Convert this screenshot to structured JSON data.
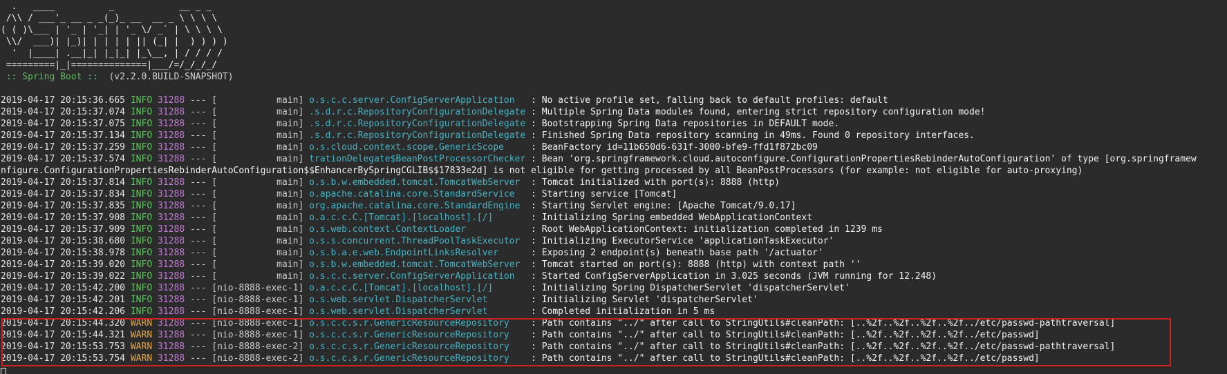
{
  "banner": {
    "art": "  .   ____          _            __ _ _\n /\\\\ / ___'_ __ _ _(_)_ __  __ _ \\ \\ \\ \\\n( ( )\\___ | '_ | '_| | '_ \\/ _` | \\ \\ \\ \\\n \\\\/  ___)| |_)| | | | | || (_| |  ) ) ) )\n  '  |____| .__|_| |_|_| |_\\__, | / / / /\n =========|_|==============|___/=/_/_/_/",
    "label": " :: Spring Boot :: ",
    "version": " (v2.2.0.BUILD-SNAPSHOT)"
  },
  "log_lines": [
    {
      "ts": "2019-04-17 20:15:36.665",
      "level": " INFO",
      "pid": "31288",
      "sep": " --- [           main] ",
      "logger": "o.s.c.c.server.ConfigServerApplication  ",
      "msg": " : No active profile set, falling back to default profiles: default"
    },
    {
      "ts": "2019-04-17 20:15:37.074",
      "level": " INFO",
      "pid": "31288",
      "sep": " --- [           main] ",
      "logger": ".s.d.r.c.RepositoryConfigurationDelegate",
      "msg": " : Multiple Spring Data modules found, entering strict repository configuration mode!"
    },
    {
      "ts": "2019-04-17 20:15:37.075",
      "level": " INFO",
      "pid": "31288",
      "sep": " --- [           main] ",
      "logger": ".s.d.r.c.RepositoryConfigurationDelegate",
      "msg": " : Bootstrapping Spring Data repositories in DEFAULT mode."
    },
    {
      "ts": "2019-04-17 20:15:37.134",
      "level": " INFO",
      "pid": "31288",
      "sep": " --- [           main] ",
      "logger": ".s.d.r.c.RepositoryConfigurationDelegate",
      "msg": " : Finished Spring Data repository scanning in 49ms. Found 0 repository interfaces."
    },
    {
      "ts": "2019-04-17 20:15:37.259",
      "level": " INFO",
      "pid": "31288",
      "sep": " --- [           main] ",
      "logger": "o.s.cloud.context.scope.GenericScope    ",
      "msg": " : BeanFactory id=11b650d6-631f-3000-bfe9-ffd1f872bc09"
    },
    {
      "ts": "2019-04-17 20:15:37.574",
      "level": " INFO",
      "pid": "31288",
      "sep": " --- [           main] ",
      "logger": "trationDelegate$BeanPostProcessorChecker",
      "msg": " : Bean 'org.springframework.cloud.autoconfigure.ConfigurationPropertiesRebinderAutoConfiguration' of type [org.springframew"
    },
    {
      "wrap": "nfigure.ConfigurationPropertiesRebinderAutoConfiguration$$EnhancerBySpringCGLIB$$17833e2d] is not eligible for getting processed by all BeanPostProcessors (for example: not eligible for auto-proxying)"
    },
    {
      "ts": "2019-04-17 20:15:37.814",
      "level": " INFO",
      "pid": "31288",
      "sep": " --- [           main] ",
      "logger": "o.s.b.w.embedded.tomcat.TomcatWebServer ",
      "msg": " : Tomcat initialized with port(s): 8888 (http)"
    },
    {
      "ts": "2019-04-17 20:15:37.834",
      "level": " INFO",
      "pid": "31288",
      "sep": " --- [           main] ",
      "logger": "o.apache.catalina.core.StandardService  ",
      "msg": " : Starting service [Tomcat]"
    },
    {
      "ts": "2019-04-17 20:15:37.835",
      "level": " INFO",
      "pid": "31288",
      "sep": " --- [           main] ",
      "logger": "org.apache.catalina.core.StandardEngine ",
      "msg": " : Starting Servlet engine: [Apache Tomcat/9.0.17]"
    },
    {
      "ts": "2019-04-17 20:15:37.908",
      "level": " INFO",
      "pid": "31288",
      "sep": " --- [           main] ",
      "logger": "o.a.c.c.C.[Tomcat].[localhost].[/]      ",
      "msg": " : Initializing Spring embedded WebApplicationContext"
    },
    {
      "ts": "2019-04-17 20:15:37.909",
      "level": " INFO",
      "pid": "31288",
      "sep": " --- [           main] ",
      "logger": "o.s.web.context.ContextLoader           ",
      "msg": " : Root WebApplicationContext: initialization completed in 1239 ms"
    },
    {
      "ts": "2019-04-17 20:15:38.680",
      "level": " INFO",
      "pid": "31288",
      "sep": " --- [           main] ",
      "logger": "o.s.s.concurrent.ThreadPoolTaskExecutor ",
      "msg": " : Initializing ExecutorService 'applicationTaskExecutor'"
    },
    {
      "ts": "2019-04-17 20:15:38.978",
      "level": " INFO",
      "pid": "31288",
      "sep": " --- [           main] ",
      "logger": "o.s.b.a.e.web.EndpointLinksResolver     ",
      "msg": " : Exposing 2 endpoint(s) beneath base path '/actuator'"
    },
    {
      "ts": "2019-04-17 20:15:39.020",
      "level": " INFO",
      "pid": "31288",
      "sep": " --- [           main] ",
      "logger": "o.s.b.w.embedded.tomcat.TomcatWebServer ",
      "msg": " : Tomcat started on port(s): 8888 (http) with context path ''"
    },
    {
      "ts": "2019-04-17 20:15:39.022",
      "level": " INFO",
      "pid": "31288",
      "sep": " --- [           main] ",
      "logger": "o.s.c.c.server.ConfigServerApplication  ",
      "msg": " : Started ConfigServerApplication in 3.025 seconds (JVM running for 12.248)"
    },
    {
      "ts": "2019-04-17 20:15:42.200",
      "level": " INFO",
      "pid": "31288",
      "sep": " --- [nio-8888-exec-1] ",
      "logger": "o.a.c.c.C.[Tomcat].[localhost].[/]      ",
      "msg": " : Initializing Spring DispatcherServlet 'dispatcherServlet'"
    },
    {
      "ts": "2019-04-17 20:15:42.201",
      "level": " INFO",
      "pid": "31288",
      "sep": " --- [nio-8888-exec-1] ",
      "logger": "o.s.web.servlet.DispatcherServlet       ",
      "msg": " : Initializing Servlet 'dispatcherServlet'"
    },
    {
      "ts": "2019-04-17 20:15:42.206",
      "level": " INFO",
      "pid": "31288",
      "sep": " --- [nio-8888-exec-1] ",
      "logger": "o.s.web.servlet.DispatcherServlet       ",
      "msg": " : Completed initialization in 5 ms"
    },
    {
      "ts": "2019-04-17 20:15:44.320",
      "level": " WARN",
      "pid": "31288",
      "sep": " --- [nio-8888-exec-1] ",
      "logger": "o.s.c.c.s.r.GenericResourceRepository   ",
      "msg": " : Path contains \"../\" after call to StringUtils#cleanPath: [..%2f..%2f..%2f..%2f../etc/passwd-pathtraversal]"
    },
    {
      "ts": "2019-04-17 20:15:44.321",
      "level": " WARN",
      "pid": "31288",
      "sep": " --- [nio-8888-exec-1] ",
      "logger": "o.s.c.c.s.r.GenericResourceRepository   ",
      "msg": " : Path contains \"../\" after call to StringUtils#cleanPath: [..%2f..%2f..%2f..%2f../etc/passwd]"
    },
    {
      "ts": "2019-04-17 20:15:53.753",
      "level": " WARN",
      "pid": "31288",
      "sep": " --- [nio-8888-exec-2] ",
      "logger": "o.s.c.c.s.r.GenericResourceRepository   ",
      "msg": " : Path contains \"../\" after call to StringUtils#cleanPath: [..%2f..%2f..%2f..%2f../etc/passwd-pathtraversal]"
    },
    {
      "ts": "2019-04-17 20:15:53.754",
      "level": " WARN",
      "pid": "31288",
      "sep": " --- [nio-8888-exec-2] ",
      "logger": "o.s.c.c.s.r.GenericResourceRepository   ",
      "msg": " : Path contains \"../\" after call to StringUtils#cleanPath: [..%2f..%2f..%2f..%2f../etc/passwd]"
    }
  ],
  "colors": {
    "background": "#2b2b2b",
    "info": "#62c462",
    "warn": "#e5a54b",
    "pid": "#c678dd",
    "logger": "#46b3c4",
    "highlight_border": "#d02020"
  }
}
